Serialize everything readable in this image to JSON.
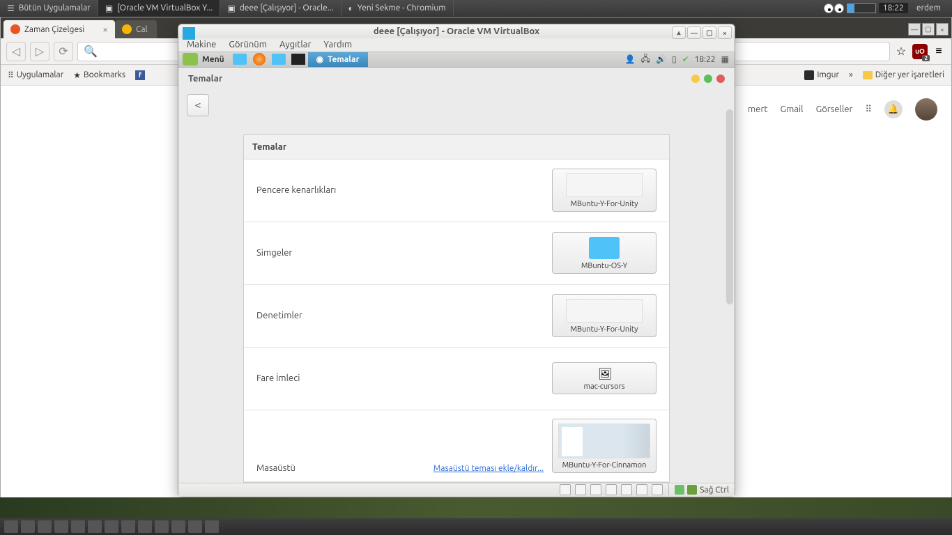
{
  "host_panel": {
    "tasks": [
      "Bütün Uygulamalar",
      "[Oracle VM VirtualBox Y...",
      "deee [Çalışıyor] - Oracle...",
      "Yeni Sekme - Chromium"
    ],
    "clock": "18:22",
    "user": "erdem"
  },
  "browser": {
    "tabs": [
      {
        "label": "Zaman Çizelgesi",
        "active": true
      },
      {
        "label": "Cal",
        "active": false
      }
    ],
    "ublock_badge": "2",
    "bookmarks": [
      "Uygulamalar",
      "Bookmarks"
    ],
    "right_bookmarks": [
      "Imgur"
    ],
    "overflow": "»",
    "other_bookmarks": "Diğer yer işaretleri",
    "google_links": [
      "mert",
      "Gmail",
      "Görseller"
    ]
  },
  "vbox": {
    "title": "deee [Çalışıyor] - Oracle VM VirtualBox",
    "menus": [
      "Makine",
      "Görünüm",
      "Aygıtlar",
      "Yardım"
    ],
    "vm_menu": "Menü",
    "vm_task": "Temalar",
    "vm_clock": "18:22",
    "themes_title": "Temalar",
    "section_title": "Temalar",
    "rows": [
      {
        "label": "Pencere kenarlıkları",
        "value": "MBuntu-Y-For-Unity",
        "kind": "blank"
      },
      {
        "label": "Simgeler",
        "value": "MBuntu-OS-Y",
        "kind": "folder"
      },
      {
        "label": "Denetimler",
        "value": "MBuntu-Y-For-Unity",
        "kind": "blank"
      },
      {
        "label": "Fare İmleci",
        "value": "mac-cursors",
        "kind": "img"
      },
      {
        "label": "Masaüstü",
        "value": "MBuntu-Y-For-Cinnamon",
        "kind": "desk"
      }
    ],
    "desk_link": "Masaüstü teması ekle/kaldır...",
    "hostkey": "Sağ Ctrl"
  }
}
